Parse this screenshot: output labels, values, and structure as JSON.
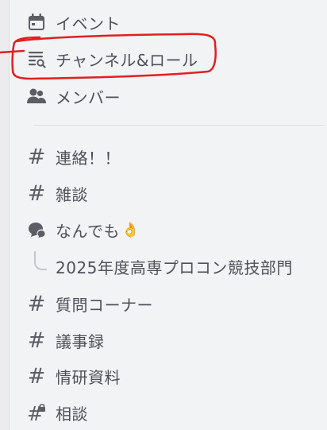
{
  "sidebar": {
    "events_label": "イベント",
    "channels_roles_label": "チャンネル&ロール",
    "members_label": "メンバー",
    "channels": [
      {
        "name": "連絡！！",
        "icon": "hash-icon"
      },
      {
        "name": "雑談",
        "icon": "hash-icon"
      },
      {
        "name": "なんでも",
        "icon": "forum-icon",
        "emoji": "👌"
      },
      {
        "name": "2025年度高専プロコン競技部門",
        "icon": "thread-branch"
      },
      {
        "name": "質問コーナー",
        "icon": "hash-icon"
      },
      {
        "name": "議事録",
        "icon": "hash-icon"
      },
      {
        "name": "情研資料",
        "icon": "hash-icon"
      },
      {
        "name": "相談",
        "icon": "hash-lock-icon"
      }
    ]
  },
  "colors": {
    "text": "#4e5058",
    "icon": "#5c5e66",
    "background": "#f2f3f5",
    "annotation_red": "#e02020"
  }
}
